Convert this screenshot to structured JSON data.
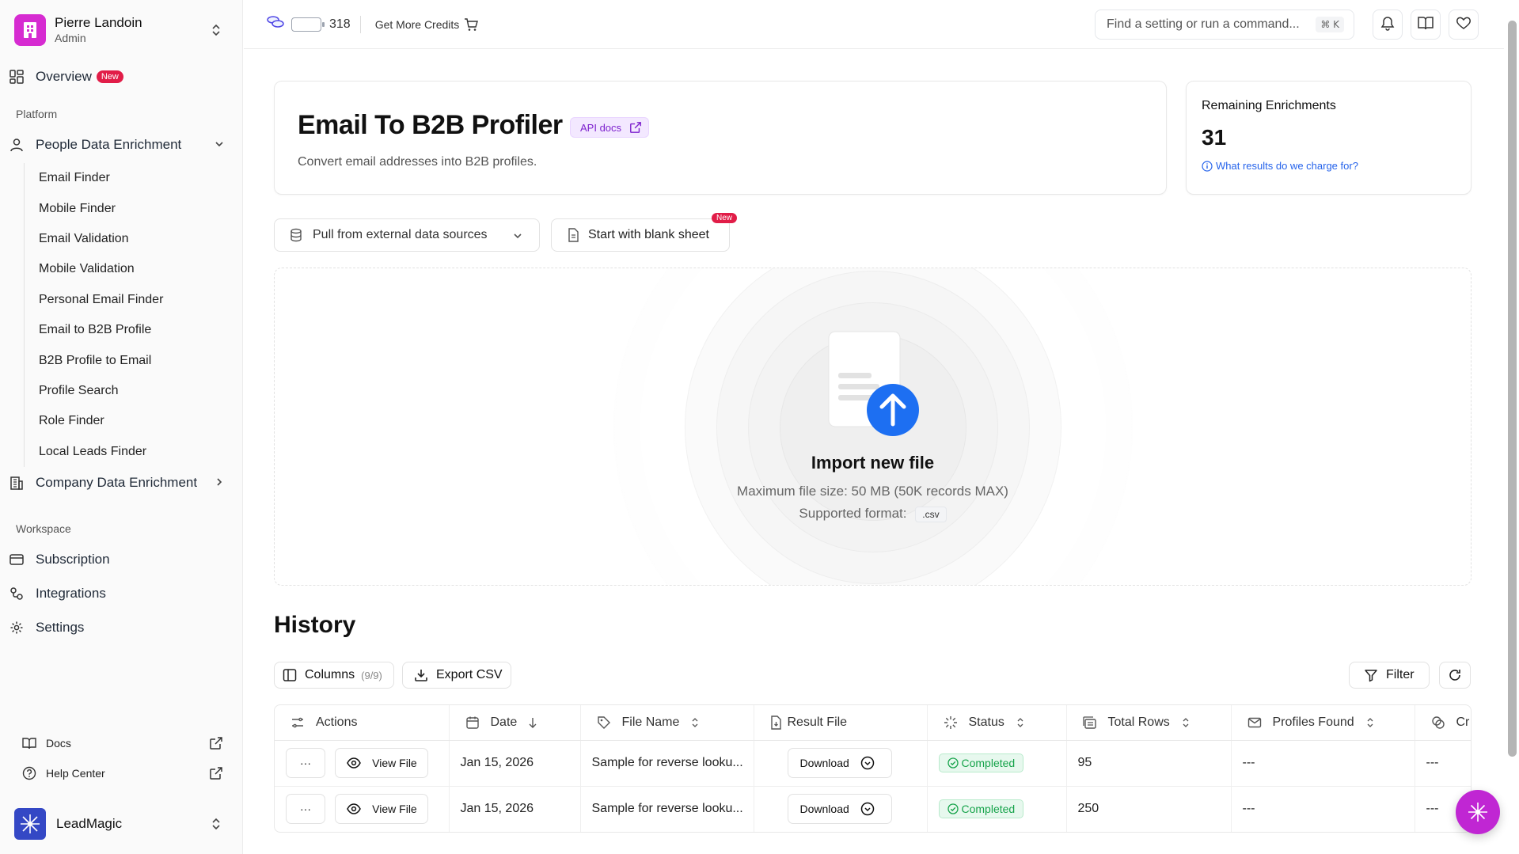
{
  "user": {
    "name": "Pierre Landoin",
    "role": "Admin",
    "avatar_color": "#d62bd1"
  },
  "sidebar": {
    "overview": {
      "label": "Overview",
      "badge": "New"
    },
    "platform_label": "Platform",
    "people_group": {
      "label": "People Data Enrichment"
    },
    "people_items": [
      {
        "label": "Email Finder"
      },
      {
        "label": "Mobile Finder"
      },
      {
        "label": "Email Validation"
      },
      {
        "label": "Mobile Validation"
      },
      {
        "label": "Personal Email Finder"
      },
      {
        "label": "Email to B2B Profile"
      },
      {
        "label": "B2B Profile to Email"
      },
      {
        "label": "Profile Search"
      },
      {
        "label": "Role Finder"
      },
      {
        "label": "Local Leads Finder"
      }
    ],
    "company_group": {
      "label": "Company Data Enrichment"
    },
    "workspace_label": "Workspace",
    "workspace_items": [
      {
        "label": "Subscription"
      },
      {
        "label": "Integrations"
      },
      {
        "label": "Settings"
      }
    ],
    "footer": {
      "docs": "Docs",
      "help": "Help Center"
    },
    "brand": {
      "name": "LeadMagic"
    }
  },
  "topbar": {
    "credits": "318",
    "get_credits": "Get More Credits",
    "search_placeholder": "Find a setting or run a command...",
    "shortcut": "⌘ K"
  },
  "header": {
    "title": "Email To B2B Profiler",
    "api_docs": "API docs",
    "subtitle": "Convert email addresses into B2B profiles."
  },
  "enrichments": {
    "title": "Remaining Enrichments",
    "value": "31",
    "link": "What results do we charge for?"
  },
  "sources": {
    "pull_label": "Pull from external data sources",
    "blank_label": "Start with blank sheet",
    "blank_badge": "New"
  },
  "import": {
    "title": "Import new file",
    "max_size": "Maximum file size: 50 MB (50K records MAX)",
    "format_label": "Supported format:",
    "format_value": ".csv"
  },
  "history": {
    "title": "History",
    "columns_label": "Columns",
    "columns_count": "(9/9)",
    "export_label": "Export CSV",
    "filter_label": "Filter",
    "headers": {
      "actions": "Actions",
      "date": "Date",
      "file_name": "File Name",
      "result_file": "Result File",
      "status": "Status",
      "total_rows": "Total Rows",
      "profiles_found": "Profiles Found",
      "credits_partial": "Cr"
    },
    "rows": [
      {
        "more": "···",
        "view": "View File",
        "date": "Jan 15, 2026",
        "file_name": "Sample for reverse looku...",
        "download": "Download",
        "status": "Completed",
        "total_rows": "95",
        "profiles_found": "---",
        "credits": "---"
      },
      {
        "more": "···",
        "view": "View File",
        "date": "Jan 15, 2026",
        "file_name": "Sample for reverse looku...",
        "download": "Download",
        "status": "Completed",
        "total_rows": "250",
        "profiles_found": "---",
        "credits": "---"
      }
    ]
  },
  "colors": {
    "accent_blue": "#1d6ff2",
    "brand_purple": "#c026d3",
    "success": "#16a34a"
  }
}
